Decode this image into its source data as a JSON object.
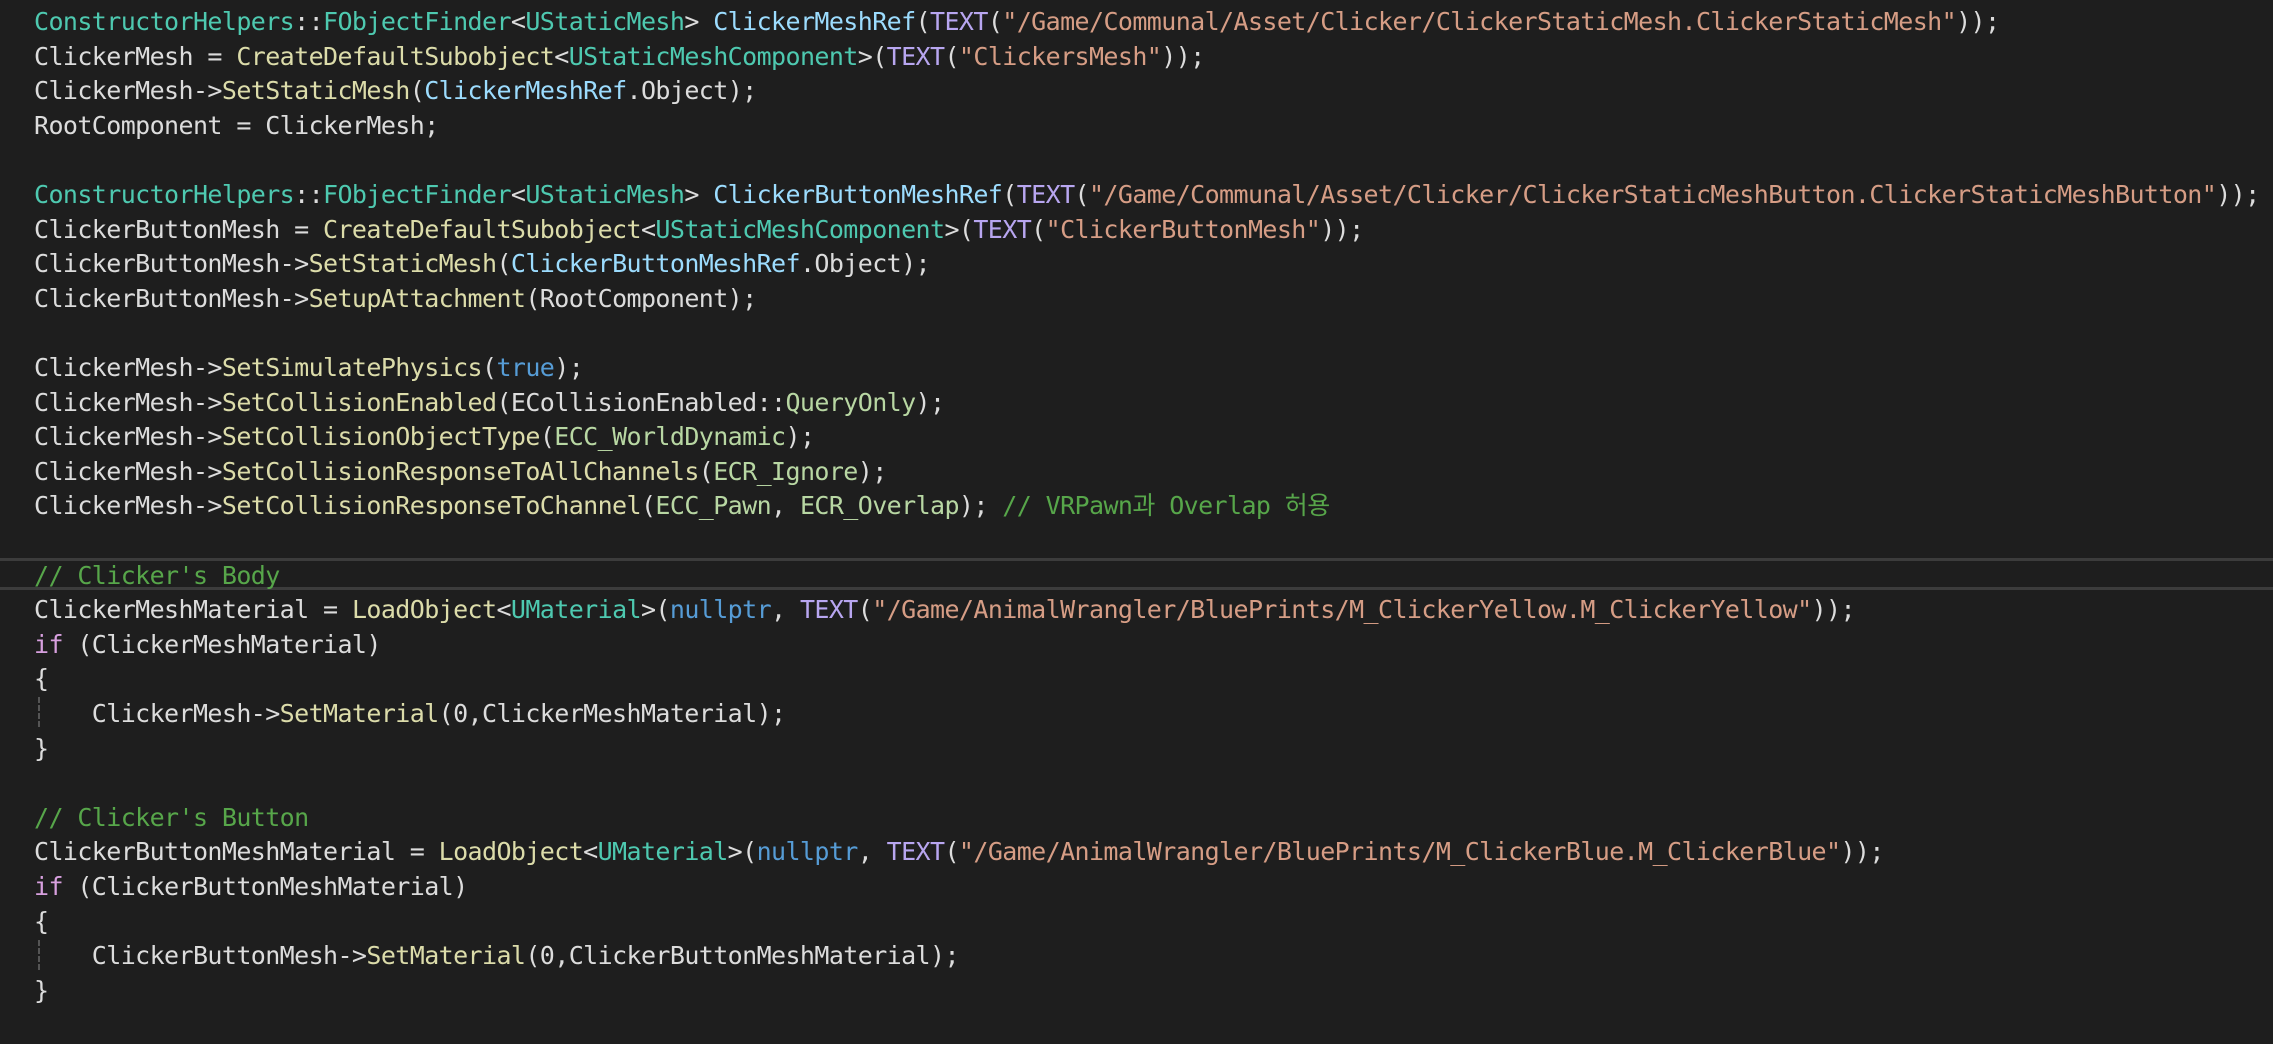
{
  "editor": {
    "lines": [
      [
        [
          "cls",
          "ConstructorHelpers"
        ],
        [
          "pln",
          "::"
        ],
        [
          "cls",
          "FObjectFinder"
        ],
        [
          "pln",
          "<"
        ],
        [
          "cls",
          "UStaticMesh"
        ],
        [
          "pln",
          "> "
        ],
        [
          "id",
          "ClickerMeshRef"
        ],
        [
          "pln",
          "("
        ],
        [
          "mac",
          "TEXT"
        ],
        [
          "pln",
          "("
        ],
        [
          "str",
          "\"/Game/Communal/Asset/Clicker/ClickerStaticMesh.ClickerStaticMesh\""
        ],
        [
          "pln",
          "));"
        ]
      ],
      [
        [
          "pln",
          "ClickerMesh = "
        ],
        [
          "fn",
          "CreateDefaultSubobject"
        ],
        [
          "pln",
          "<"
        ],
        [
          "cls",
          "UStaticMeshComponent"
        ],
        [
          "pln",
          ">("
        ],
        [
          "mac",
          "TEXT"
        ],
        [
          "pln",
          "("
        ],
        [
          "str",
          "\"ClickersMesh\""
        ],
        [
          "pln",
          "));"
        ]
      ],
      [
        [
          "pln",
          "ClickerMesh->"
        ],
        [
          "fn",
          "SetStaticMesh"
        ],
        [
          "pln",
          "("
        ],
        [
          "id",
          "ClickerMeshRef"
        ],
        [
          "pln",
          ".Object);"
        ]
      ],
      [
        [
          "pln",
          "RootComponent = ClickerMesh;"
        ]
      ],
      [],
      [
        [
          "cls",
          "ConstructorHelpers"
        ],
        [
          "pln",
          "::"
        ],
        [
          "cls",
          "FObjectFinder"
        ],
        [
          "pln",
          "<"
        ],
        [
          "cls",
          "UStaticMesh"
        ],
        [
          "pln",
          "> "
        ],
        [
          "id",
          "ClickerButtonMeshRef"
        ],
        [
          "pln",
          "("
        ],
        [
          "mac",
          "TEXT"
        ],
        [
          "pln",
          "("
        ],
        [
          "str",
          "\"/Game/Communal/Asset/Clicker/ClickerStaticMeshButton.ClickerStaticMeshButton\""
        ],
        [
          "pln",
          "));"
        ]
      ],
      [
        [
          "pln",
          "ClickerButtonMesh = "
        ],
        [
          "fn",
          "CreateDefaultSubobject"
        ],
        [
          "pln",
          "<"
        ],
        [
          "cls",
          "UStaticMeshComponent"
        ],
        [
          "pln",
          ">("
        ],
        [
          "mac",
          "TEXT"
        ],
        [
          "pln",
          "("
        ],
        [
          "str",
          "\"ClickerButtonMesh\""
        ],
        [
          "pln",
          "));"
        ]
      ],
      [
        [
          "pln",
          "ClickerButtonMesh->"
        ],
        [
          "fn",
          "SetStaticMesh"
        ],
        [
          "pln",
          "("
        ],
        [
          "id",
          "ClickerButtonMeshRef"
        ],
        [
          "pln",
          ".Object);"
        ]
      ],
      [
        [
          "pln",
          "ClickerButtonMesh->"
        ],
        [
          "fn",
          "SetupAttachment"
        ],
        [
          "pln",
          "(RootComponent);"
        ]
      ],
      [],
      [
        [
          "pln",
          "ClickerMesh->"
        ],
        [
          "fn",
          "SetSimulatePhysics"
        ],
        [
          "pln",
          "("
        ],
        [
          "kw",
          "true"
        ],
        [
          "pln",
          ");"
        ]
      ],
      [
        [
          "pln",
          "ClickerMesh->"
        ],
        [
          "fn",
          "SetCollisionEnabled"
        ],
        [
          "pln",
          "(ECollisionEnabled::"
        ],
        [
          "enm",
          "QueryOnly"
        ],
        [
          "pln",
          ");"
        ]
      ],
      [
        [
          "pln",
          "ClickerMesh->"
        ],
        [
          "fn",
          "SetCollisionObjectType"
        ],
        [
          "pln",
          "("
        ],
        [
          "enm",
          "ECC_WorldDynamic"
        ],
        [
          "pln",
          ");"
        ]
      ],
      [
        [
          "pln",
          "ClickerMesh->"
        ],
        [
          "fn",
          "SetCollisionResponseToAllChannels"
        ],
        [
          "pln",
          "("
        ],
        [
          "enm",
          "ECR_Ignore"
        ],
        [
          "pln",
          ");"
        ]
      ],
      [
        [
          "pln",
          "ClickerMesh->"
        ],
        [
          "fn",
          "SetCollisionResponseToChannel"
        ],
        [
          "pln",
          "("
        ],
        [
          "enm",
          "ECC_Pawn"
        ],
        [
          "pln",
          ", "
        ],
        [
          "enm",
          "ECR_Overlap"
        ],
        [
          "pln",
          "); "
        ],
        [
          "cmt",
          "// VRPawn과 Overlap 허용"
        ]
      ],
      [],
      [
        [
          "cmt",
          "// Clicker's Body"
        ]
      ],
      [
        [
          "pln",
          "ClickerMeshMaterial = "
        ],
        [
          "fn",
          "LoadObject"
        ],
        [
          "pln",
          "<"
        ],
        [
          "cls",
          "UMaterial"
        ],
        [
          "pln",
          ">("
        ],
        [
          "kw",
          "nullptr"
        ],
        [
          "pln",
          ", "
        ],
        [
          "mac",
          "TEXT"
        ],
        [
          "pln",
          "("
        ],
        [
          "str",
          "\"/Game/AnimalWrangler/BluePrints/M_ClickerYellow.M_ClickerYellow\""
        ],
        [
          "pln",
          "));"
        ]
      ],
      [
        [
          "ctl",
          "if"
        ],
        [
          "pln",
          " (ClickerMeshMaterial)"
        ]
      ],
      [
        [
          "pln",
          "{"
        ]
      ],
      [
        [
          "pln",
          "    ClickerMesh->"
        ],
        [
          "fn",
          "SetMaterial"
        ],
        [
          "pln",
          "(0,ClickerMeshMaterial);"
        ]
      ],
      [
        [
          "pln",
          "}"
        ]
      ],
      [],
      [
        [
          "cmt",
          "// Clicker's Button"
        ]
      ],
      [
        [
          "pln",
          "ClickerButtonMeshMaterial = "
        ],
        [
          "fn",
          "LoadObject"
        ],
        [
          "pln",
          "<"
        ],
        [
          "cls",
          "UMaterial"
        ],
        [
          "pln",
          ">("
        ],
        [
          "kw",
          "nullptr"
        ],
        [
          "pln",
          ", "
        ],
        [
          "mac",
          "TEXT"
        ],
        [
          "pln",
          "("
        ],
        [
          "str",
          "\"/Game/AnimalWrangler/BluePrints/M_ClickerBlue.M_ClickerBlue\""
        ],
        [
          "pln",
          "));"
        ]
      ],
      [
        [
          "ctl",
          "if"
        ],
        [
          "pln",
          " (ClickerButtonMeshMaterial)"
        ]
      ],
      [
        [
          "pln",
          "{"
        ]
      ],
      [
        [
          "pln",
          "    ClickerButtonMesh->"
        ],
        [
          "fn",
          "SetMaterial"
        ],
        [
          "pln",
          "(0,ClickerButtonMeshMaterial);"
        ]
      ],
      [
        [
          "pln",
          "}"
        ]
      ]
    ]
  },
  "colors": {
    "background": "#1e1e1e",
    "class": "#4ec9b0",
    "function": "#dcdcaa",
    "keyword": "#569cd6",
    "macro": "#b8a6f0",
    "string": "#d69d85",
    "comment": "#57a64a",
    "identifier": "#9cdcfe",
    "plain": "#dcdcdc"
  }
}
